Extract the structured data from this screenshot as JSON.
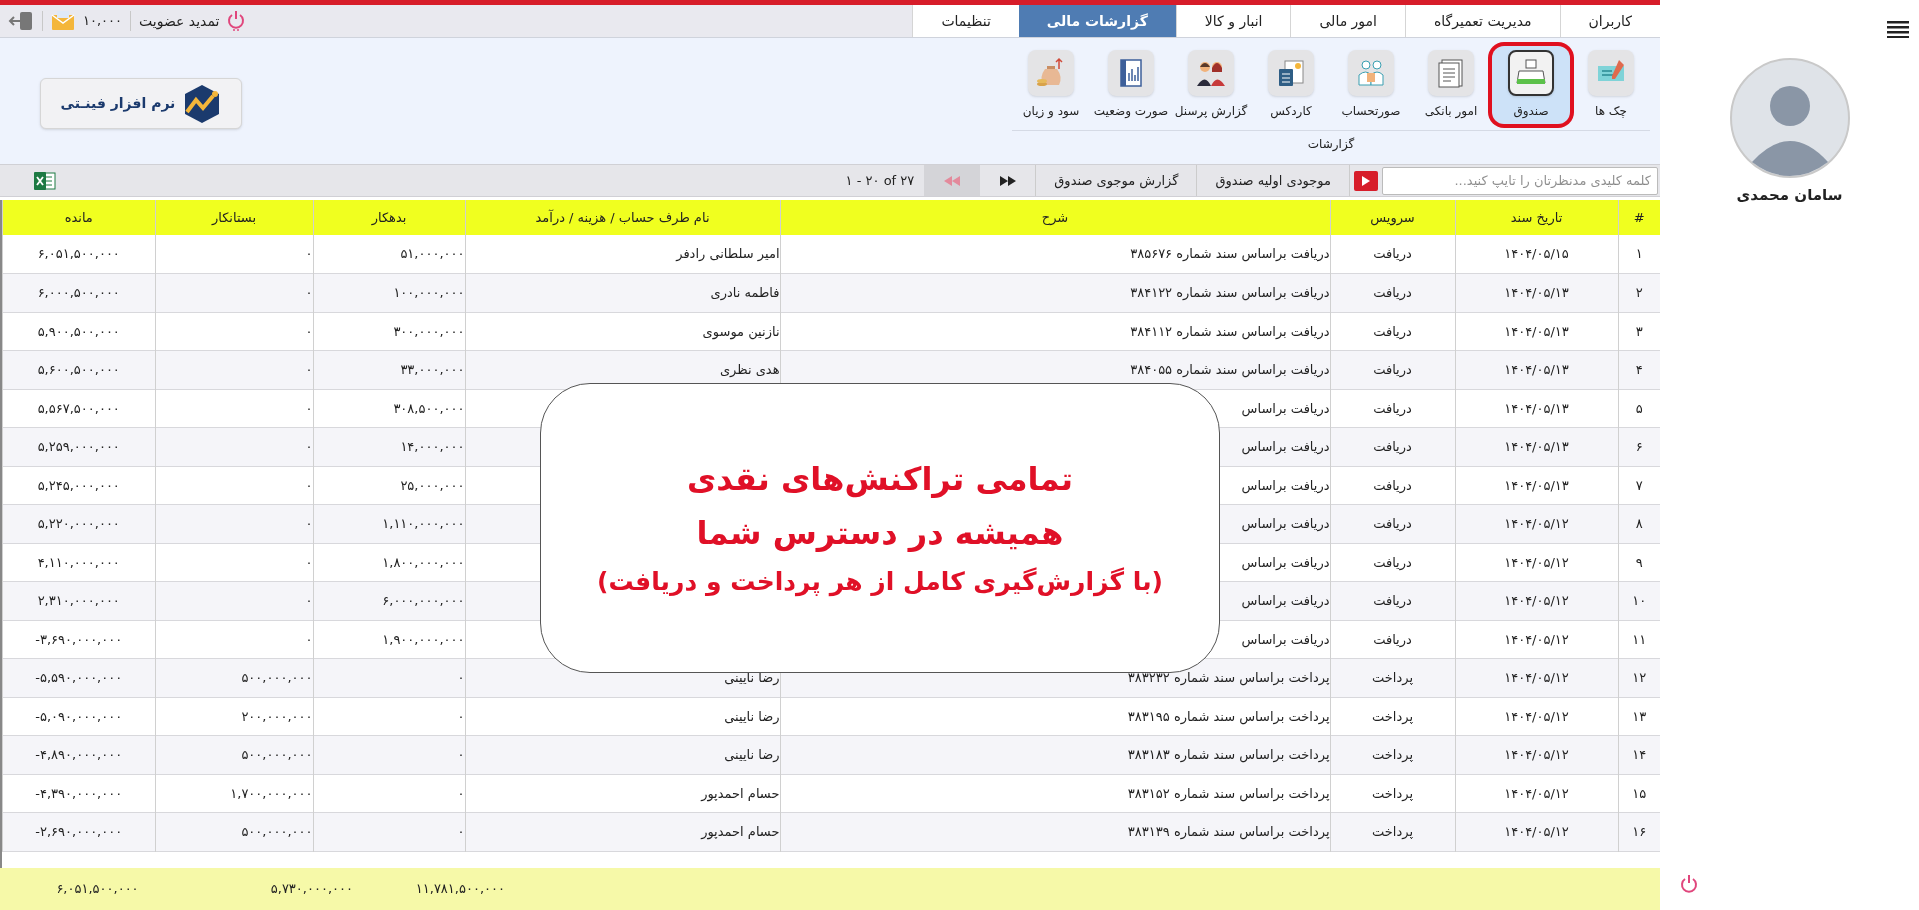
{
  "tabs": [
    {
      "label": "کاربران",
      "selected": false
    },
    {
      "label": "مدیریت تعمیرگاه",
      "selected": false
    },
    {
      "label": "امور مالی",
      "selected": false
    },
    {
      "label": "انبار و کالا",
      "selected": false
    },
    {
      "label": "گزارشات مالی",
      "selected": true
    },
    {
      "label": "تنظیمات",
      "selected": false
    }
  ],
  "header_actions": {
    "renew": "تمدید عضویت",
    "sms_credit": "۱۰,۰۰۰"
  },
  "ribbon": {
    "items": [
      {
        "label": "چک ها",
        "selected": false
      },
      {
        "label": "صندوق",
        "selected": true
      },
      {
        "label": "امور بانکی",
        "selected": false
      },
      {
        "label": "صورتحساب",
        "selected": false
      },
      {
        "label": "کاردکس",
        "selected": false
      },
      {
        "label": "گزارش پرسنل",
        "selected": false
      },
      {
        "label": "صورت وضعیت",
        "selected": false
      },
      {
        "label": "سود و زیان",
        "selected": false
      }
    ],
    "group": "گزارشات",
    "logo": "نرم افزار فینـتی"
  },
  "search": {
    "placeholder": "کلمه کلیدی مدنظرتان را تایپ کنید..."
  },
  "actions": [
    "موجودی اولیه صندوق",
    "گزارش موجوی صندوق"
  ],
  "pagination": "۱ - ۲۰ of ۲۷",
  "table": {
    "columns": [
      "#",
      "تاریخ سند",
      "سرویس",
      "شرح",
      "نام طرف حساب / هزینه / درآمد",
      "بدهکار",
      "بستانکار",
      "مانده"
    ],
    "rows": [
      {
        "number": "۱",
        "date": "۱۴۰۴/۰۵/۱۵",
        "service": "دریافت",
        "description": "دریافت براساس سند شماره ۳۸۵۶۷۶",
        "party": "امیر سلطانی رادفر",
        "debit": "۵۱,۰۰۰,۰۰۰",
        "credit": "۰",
        "balance": "۶,۰۵۱,۵۰۰,۰۰۰"
      },
      {
        "number": "۲",
        "date": "۱۴۰۴/۰۵/۱۳",
        "service": "دریافت",
        "description": "دریافت براساس سند شماره ۳۸۴۱۲۲",
        "party": "فاطمه نادری",
        "debit": "۱۰۰,۰۰۰,۰۰۰",
        "credit": "۰",
        "balance": "۶,۰۰۰,۵۰۰,۰۰۰"
      },
      {
        "number": "۳",
        "date": "۱۴۰۴/۰۵/۱۳",
        "service": "دریافت",
        "description": "دریافت براساس سند شماره ۳۸۴۱۱۲",
        "party": "نازنین موسوی",
        "debit": "۳۰۰,۰۰۰,۰۰۰",
        "credit": "۰",
        "balance": "۵,۹۰۰,۵۰۰,۰۰۰"
      },
      {
        "number": "۴",
        "date": "۱۴۰۴/۰۵/۱۳",
        "service": "دریافت",
        "description": "دریافت براساس سند شماره ۳۸۴۰۵۵",
        "party": "هدی نظری",
        "debit": "۳۳,۰۰۰,۰۰۰",
        "credit": "۰",
        "balance": "۵,۶۰۰,۵۰۰,۰۰۰"
      },
      {
        "number": "۵",
        "date": "۱۴۰۴/۰۵/۱۳",
        "service": "دریافت",
        "description": "دریافت براساس",
        "debit": "۳۰۸,۵۰۰,۰۰۰",
        "credit": "۰",
        "balance": "۵,۵۶۷,۵۰۰,۰۰۰"
      },
      {
        "number": "۶",
        "date": "۱۴۰۴/۰۵/۱۳",
        "service": "دریافت",
        "description": "دریافت براساس",
        "debit": "۱۴,۰۰۰,۰۰۰",
        "credit": "۰",
        "balance": "۵,۲۵۹,۰۰۰,۰۰۰"
      },
      {
        "number": "۷",
        "date": "۱۴۰۴/۰۵/۱۳",
        "service": "دریافت",
        "description": "دریافت براساس",
        "debit": "۲۵,۰۰۰,۰۰۰",
        "credit": "۰",
        "balance": "۵,۲۴۵,۰۰۰,۰۰۰"
      },
      {
        "number": "۸",
        "date": "۱۴۰۴/۰۵/۱۲",
        "service": "دریافت",
        "description": "دریافت براساس",
        "debit": "۱,۱۱۰,۰۰۰,۰۰۰",
        "credit": "۰",
        "balance": "۵,۲۲۰,۰۰۰,۰۰۰"
      },
      {
        "number": "۹",
        "date": "۱۴۰۴/۰۵/۱۲",
        "service": "دریافت",
        "description": "دریافت براساس",
        "debit": "۱,۸۰۰,۰۰۰,۰۰۰",
        "credit": "۰",
        "balance": "۴,۱۱۰,۰۰۰,۰۰۰"
      },
      {
        "number": "۱۰",
        "date": "۱۴۰۴/۰۵/۱۲",
        "service": "دریافت",
        "description": "دریافت براساس",
        "debit": "۶,۰۰۰,۰۰۰,۰۰۰",
        "credit": "۰",
        "balance": "۲,۳۱۰,۰۰۰,۰۰۰"
      },
      {
        "number": "۱۱",
        "date": "۱۴۰۴/۰۵/۱۲",
        "service": "دریافت",
        "description": "دریافت براساس",
        "debit": "۱,۹۰۰,۰۰۰,۰۰۰",
        "credit": "۰",
        "balance": "-۳,۶۹۰,۰۰۰,۰۰۰"
      },
      {
        "number": "۱۲",
        "date": "۱۴۰۴/۰۵/۱۲",
        "service": "پرداخت",
        "description": "پرداخت براساس سند شماره ۳۸۳۲۳۲",
        "party": "رضا نایینی",
        "debit": "۰",
        "credit": "۵۰۰,۰۰۰,۰۰۰",
        "balance": "-۵,۵۹۰,۰۰۰,۰۰۰"
      },
      {
        "number": "۱۳",
        "date": "۱۴۰۴/۰۵/۱۲",
        "service": "پرداخت",
        "description": "پرداخت براساس سند شماره ۳۸۳۱۹۵",
        "party": "رضا نایینی",
        "debit": "۰",
        "credit": "۲۰۰,۰۰۰,۰۰۰",
        "balance": "-۵,۰۹۰,۰۰۰,۰۰۰"
      },
      {
        "number": "۱۴",
        "date": "۱۴۰۴/۰۵/۱۲",
        "service": "پرداخت",
        "description": "پرداخت براساس سند شماره ۳۸۳۱۸۳",
        "party": "رضا نایینی",
        "debit": "۰",
        "credit": "۵۰۰,۰۰۰,۰۰۰",
        "balance": "-۴,۸۹۰,۰۰۰,۰۰۰"
      },
      {
        "number": "۱۵",
        "date": "۱۴۰۴/۰۵/۱۲",
        "service": "پرداخت",
        "description": "پرداخت براساس سند شماره ۳۸۳۱۵۲",
        "party": "حسام احمدپور",
        "debit": "۰",
        "credit": "۱,۷۰۰,۰۰۰,۰۰۰",
        "balance": "-۴,۳۹۰,۰۰۰,۰۰۰"
      },
      {
        "number": "۱۶",
        "date": "۱۴۰۴/۰۵/۱۲",
        "service": "پرداخت",
        "description": "پرداخت براساس سند شماره ۳۸۳۱۳۹",
        "party": "حسام احمدپور",
        "debit": "۰",
        "credit": "۵۰۰,۰۰۰,۰۰۰",
        "balance": "-۲,۶۹۰,۰۰۰,۰۰۰"
      }
    ],
    "totals": {
      "debit": "۱۱,۷۸۱,۵۰۰,۰۰۰",
      "credit": "۵,۷۳۰,۰۰۰,۰۰۰",
      "balance": "۶,۰۵۱,۵۰۰,۰۰۰"
    }
  },
  "promo": [
    "تمامی تراکنش‌های نقدی",
    "همیشه در دسترس شما",
    "(با گزارش‌گیری کامل از هر پرداخت و دریافت)"
  ],
  "profile": {
    "name": "سامان محمدی"
  }
}
